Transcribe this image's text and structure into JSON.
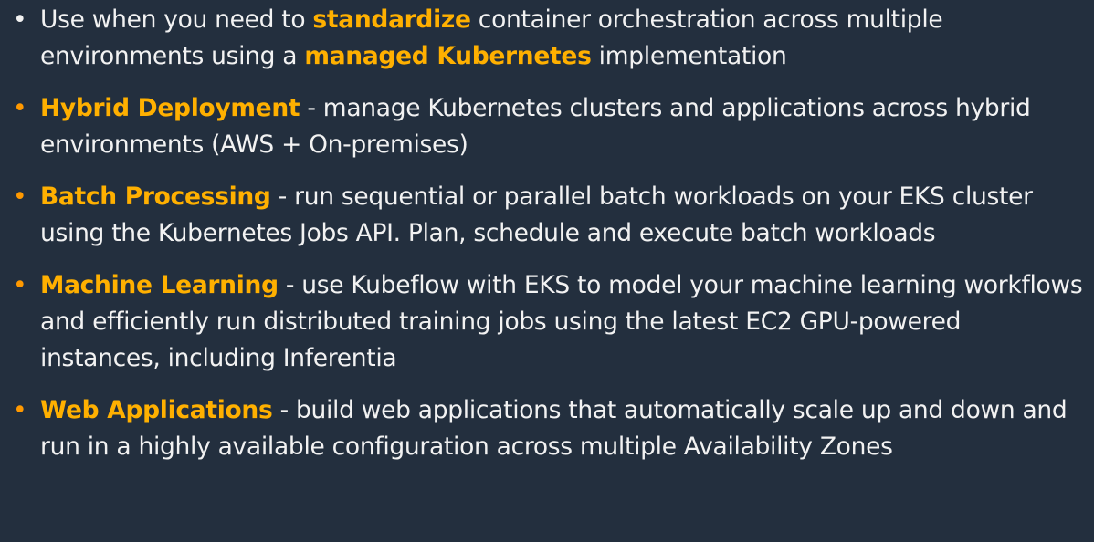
{
  "bullets": [
    {
      "parts": [
        {
          "text": "Use when you need to ",
          "highlight": false
        },
        {
          "text": "standardize",
          "highlight": true
        },
        {
          "text": " container orchestration across multiple environments using a ",
          "highlight": false
        },
        {
          "text": "managed Kubernetes",
          "highlight": true
        },
        {
          "text": " implementation",
          "highlight": false
        }
      ]
    },
    {
      "title": "Hybrid Deployment",
      "text": " - manage Kubernetes clusters and applications across hybrid environments (AWS + On-premises)"
    },
    {
      "title": "Batch Processing",
      "text": " - run sequential or parallel batch workloads on your EKS cluster using the Kubernetes Jobs API. Plan, schedule and execute batch workloads"
    },
    {
      "title": "Machine Learning",
      "text": " - use Kubeflow with EKS to model your machine learning workflows and efficiently run distributed training jobs using the latest EC2 GPU-powered instances, including Inferentia"
    },
    {
      "title": "Web Applications",
      "text": " - build web applications that automatically scale up and down and run in a highly available configuration across multiple Availability Zones"
    }
  ],
  "colors": {
    "background": "#232f3e",
    "text": "#f2f2f2",
    "highlight": "#ffb000",
    "bullet_accent": "#ff9900"
  }
}
